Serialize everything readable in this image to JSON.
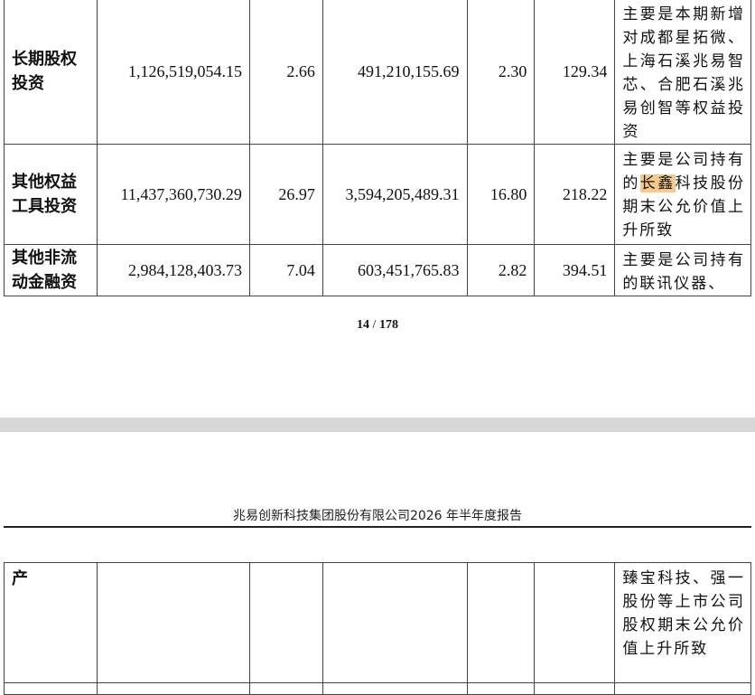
{
  "rows_top": [
    {
      "name_l1": "长期股权",
      "name_l2": "投资",
      "current_amount": "1,126,519,054.15",
      "current_pct": "2.66",
      "prior_amount": "491,210,155.69",
      "prior_pct": "2.30",
      "change_pct": "129.34",
      "note": "主要是本期新增对成都星拓微、上海石溪兆易智芯、合肥石溪兆易创智等权益投资"
    },
    {
      "name_l1": "其他权益",
      "name_l2": "工具投资",
      "current_amount": "11,437,360,730.29",
      "current_pct": "26.97",
      "prior_amount": "3,594,205,489.31",
      "prior_pct": "16.80",
      "change_pct": "218.22",
      "note_pre": "主要是公司持有的",
      "note_hl": "长鑫",
      "note_post": "科技股份期末公允价值上升所致"
    },
    {
      "name_l1": "其他非流",
      "name_l2": "动金融资",
      "current_amount": "2,984,128,403.73",
      "current_pct": "7.04",
      "prior_amount": "603,451,765.83",
      "prior_pct": "2.82",
      "change_pct": "394.51",
      "note": "主要是公司持有的联讯仪器、"
    }
  ],
  "page_number": {
    "current": "14",
    "separator": "/",
    "total": "178"
  },
  "header_title": "兆易创新科技集团股份有限公司2026 年半年度报告",
  "rows_bottom": [
    {
      "name": "产",
      "note": "臻宝科技、强一股份等上市公司股权期末公允价值上升所致"
    }
  ],
  "colors": {
    "highlight": "#f7c98a",
    "page_gap": "#d7d7d7",
    "border": "#444444"
  }
}
